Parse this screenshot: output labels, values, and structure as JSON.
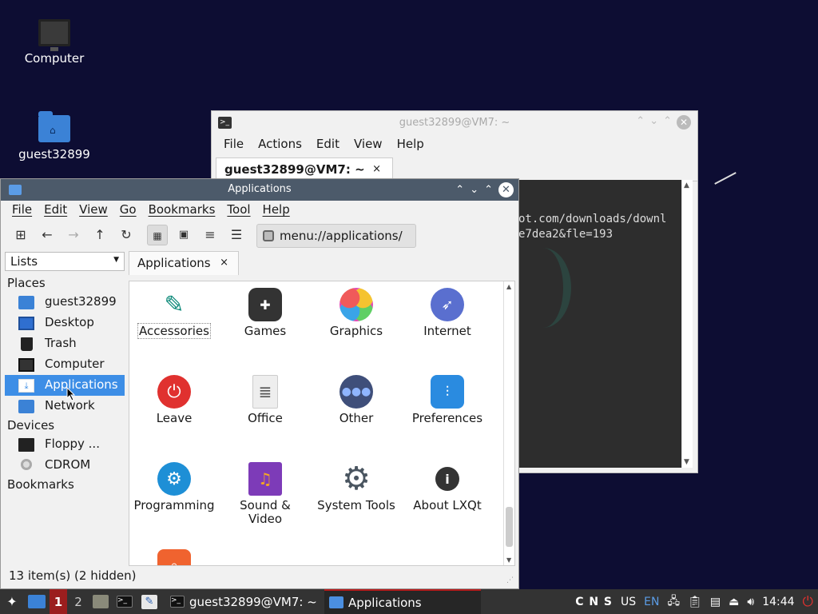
{
  "desktop": {
    "icons": [
      {
        "label": "Computer"
      },
      {
        "label": "guest32899"
      }
    ]
  },
  "terminal": {
    "title": "guest32899@VM7: ~",
    "menu": [
      "File",
      "Actions",
      "Edit",
      "View",
      "Help"
    ],
    "tab_label": "guest32899@VM7: ~",
    "tab_close": "×",
    "lines": [
      "ot.com/downloads/downl",
      "e7dea2&fle=193"
    ]
  },
  "filemanager": {
    "title": "Applications",
    "menu": [
      "File",
      "Edit",
      "View",
      "Go",
      "Bookmarks",
      "Tool",
      "Help"
    ],
    "address": "menu://applications/",
    "side_mode": "Lists",
    "places_header": "Places",
    "places": [
      "guest32899",
      "Desktop",
      "Trash",
      "Computer",
      "Applications",
      "Network"
    ],
    "devices_header": "Devices",
    "devices": [
      "Floppy ...",
      "CDROM"
    ],
    "bookmarks_header": "Bookmarks",
    "tab_label": "Applications",
    "tab_close": "×",
    "apps": [
      {
        "label": "Accessories",
        "color": "#0e8a7a"
      },
      {
        "label": "Games",
        "color": "#333333"
      },
      {
        "label": "Graphics",
        "color": "#f0a02a"
      },
      {
        "label": "Internet",
        "color": "#5a6fcf"
      },
      {
        "label": "Leave",
        "color": "#e0312f"
      },
      {
        "label": "Office",
        "color": "#dddddd"
      },
      {
        "label": "Other",
        "color": "#3f4f7a"
      },
      {
        "label": "Preferences",
        "color": "#2a8be0"
      },
      {
        "label": "Programming",
        "color": "#1e8fd6"
      },
      {
        "label": "Sound &",
        "label2": "Video",
        "color": "#7d3bb8"
      },
      {
        "label": "System Tools",
        "color": "#4a5560"
      },
      {
        "label": "About LXQt",
        "color": "#333333"
      }
    ],
    "status": "13 item(s) (2 hidden)"
  },
  "taskbar": {
    "workspaces": [
      "1",
      "2"
    ],
    "tasks": [
      {
        "label": "guest32899@VM7: ~"
      },
      {
        "label": "Applications"
      }
    ],
    "tray": {
      "indicators": "C N S",
      "lang1": "US",
      "lang2": "EN",
      "clock": "14:44"
    }
  }
}
